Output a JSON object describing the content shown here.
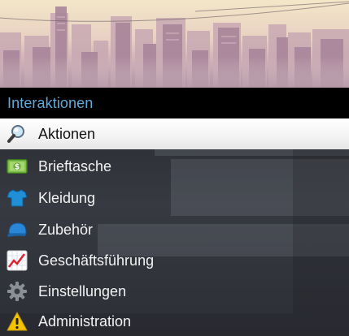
{
  "menu": {
    "title": "Interaktionen",
    "items": [
      {
        "label": "Aktionen",
        "icon": "magnifier-icon",
        "selected": true
      },
      {
        "label": "Brieftasche",
        "icon": "money-icon",
        "selected": false
      },
      {
        "label": "Kleidung",
        "icon": "shirt-icon",
        "selected": false
      },
      {
        "label": "Zubehör",
        "icon": "cap-icon",
        "selected": false
      },
      {
        "label": "Geschäftsführung",
        "icon": "chart-icon",
        "selected": false
      },
      {
        "label": "Einstellungen",
        "icon": "gear-icon",
        "selected": false
      },
      {
        "label": "Administration",
        "icon": "warning-icon",
        "selected": false
      }
    ]
  },
  "colors": {
    "title_text": "#61a9d9",
    "header_bg": "#000000",
    "selected_bg": "#ffffff",
    "item_text": "#f2f2f2"
  }
}
